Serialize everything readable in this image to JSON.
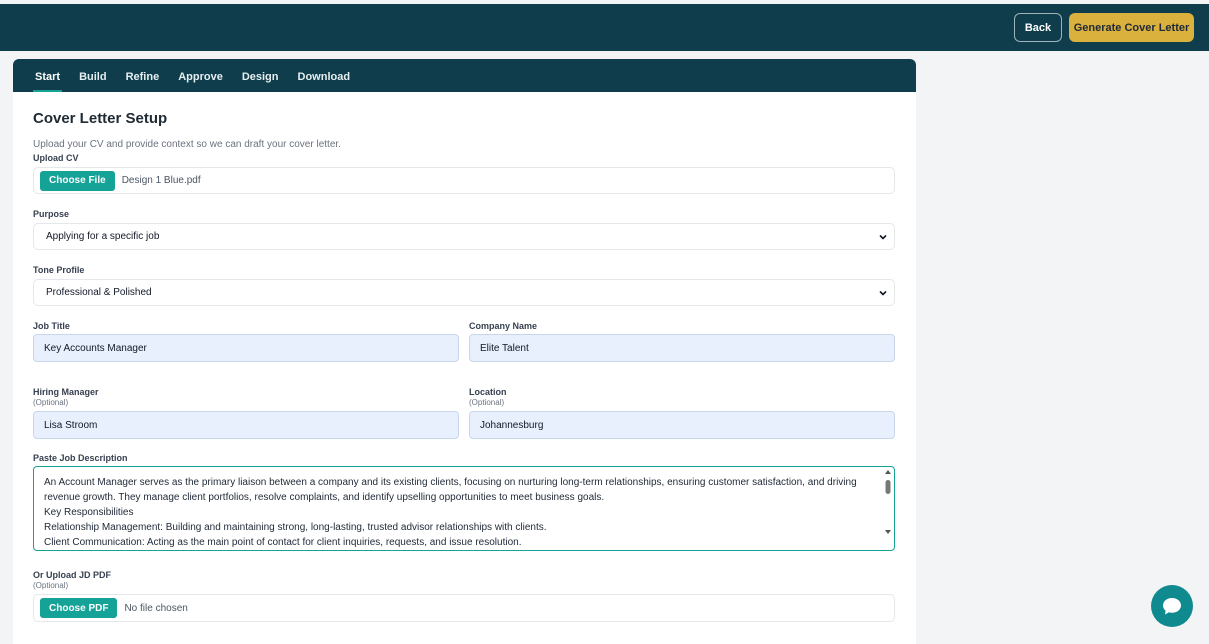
{
  "header": {
    "back_label": "Back",
    "generate_label": "Generate Cover Letter"
  },
  "tabs": [
    "Start",
    "Build",
    "Refine",
    "Approve",
    "Design",
    "Download"
  ],
  "page": {
    "title": "Cover Letter Setup",
    "subtitle": "Upload your CV and provide context so we can draft your cover letter."
  },
  "form": {
    "upload_cv": {
      "label": "Upload CV",
      "button": "Choose File",
      "filename": "Design 1 Blue.pdf"
    },
    "purpose": {
      "label": "Purpose",
      "value": "Applying for a specific job"
    },
    "tone": {
      "label": "Tone Profile",
      "value": "Professional & Polished"
    },
    "job_title": {
      "label": "Job Title",
      "value": "Key Accounts Manager"
    },
    "company": {
      "label": "Company Name",
      "value": "Elite Talent"
    },
    "hiring_manager": {
      "label": "Hiring Manager",
      "optional": "(Optional)",
      "value": "Lisa Stroom"
    },
    "location": {
      "label": "Location",
      "optional": "(Optional)",
      "value": "Johannesburg"
    },
    "job_description": {
      "label": "Paste Job Description",
      "lines": [
        "An Account Manager serves as the primary liaison between a company and its existing clients, focusing on nurturing long-term relationships, ensuring customer satisfaction, and driving",
        "revenue growth. They manage client portfolios, resolve complaints, and identify upselling opportunities to meet business goals.",
        "Key Responsibilities",
        "Relationship Management: Building and maintaining strong, long-lasting, trusted advisor relationships with clients.",
        "Client Communication: Acting as the main point of contact for client inquiries, requests, and issue resolution."
      ]
    },
    "upload_jd": {
      "label": "Or Upload JD PDF",
      "optional": "(Optional)",
      "button": "Choose PDF",
      "filename": "No file chosen"
    }
  },
  "colors": {
    "header_bg": "#0f3d4c",
    "accent": "#14a396",
    "primary_button": "#d9b13c"
  },
  "icons": [
    "chevron-down-icon",
    "chat-icon"
  ]
}
